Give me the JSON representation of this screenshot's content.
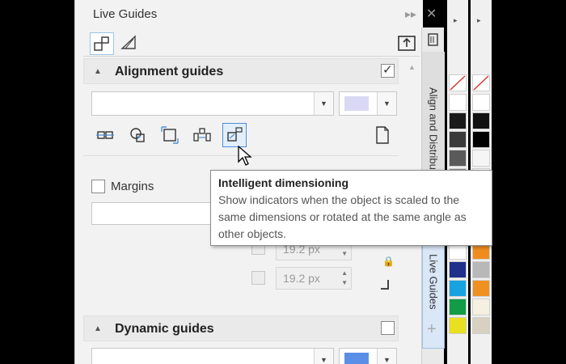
{
  "panel": {
    "title": "Live Guides",
    "expand_glyph": "▸▸",
    "close_glyph": "✕"
  },
  "alignment": {
    "title": "Alignment guides",
    "checked": true,
    "check_glyph": "✓",
    "dropdown_value": "",
    "color_swatch": "#d9d9f5"
  },
  "margins": {
    "label": "Margins",
    "checked": false,
    "dropdown_value": "",
    "spin_top_value": "19.2 px",
    "spin_bottom_value": "19.2 px"
  },
  "dynamic": {
    "title": "Dynamic guides",
    "checked": false,
    "dropdown_value": "",
    "color_swatch": "#5b8ee6"
  },
  "tooltip": {
    "title": "Intelligent dimensioning",
    "body": "Show indicators when the object is scaled to the same dimensions or rotated at the same angle as other objects."
  },
  "vertical_tabs": {
    "align_distribute": "Align and Distribute",
    "live_guides": "Live Guides",
    "add_glyph": "+"
  },
  "icons": [
    "align-object-icon",
    "align-center-icon",
    "align-frame-icon",
    "smart-spacing-icon",
    "intelligent-dimensioning-icon",
    "page-options-icon"
  ],
  "colors": {
    "accent": "#4a90d9",
    "palette1": [
      "#ffffff",
      "#1a1a1a",
      "#3a3a3a",
      "#5a5a5a",
      "#8a8a8a",
      "#d0d0d0",
      "#e0e0e0",
      "#f2f2f2",
      "#ffffff",
      "#1f2f8a",
      "#17a3e0",
      "#119c45",
      "#e8e020"
    ],
    "palette2": [
      "#ffffff",
      "#111111",
      "#000000",
      "#f5f5f5",
      "#ffffff",
      "#e8e8e8",
      "#c9956b",
      "#a87a55",
      "#f08c1e",
      "#b8b8b8",
      "#f09020",
      "#f5f0e0",
      "#d8d0c0"
    ]
  }
}
